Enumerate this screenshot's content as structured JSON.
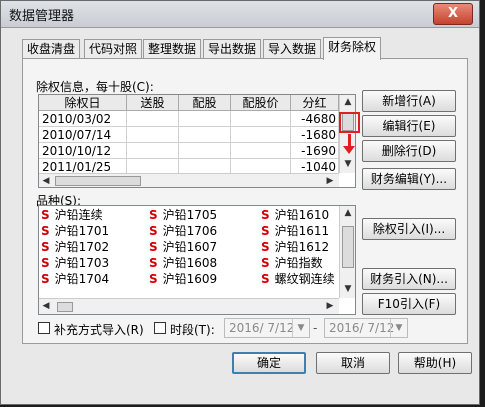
{
  "window": {
    "title": "数据管理器",
    "close_label": "X"
  },
  "tabs": [
    "收盘清盘",
    "代码对照",
    "整理数据",
    "导出数据",
    "导入数据",
    "财务除权"
  ],
  "rights_section": {
    "label": "除权信息，每十股(C):"
  },
  "grid": {
    "columns": [
      "除权日",
      "送股",
      "配股",
      "配股价",
      "分红"
    ],
    "rows": [
      [
        "2010/03/02",
        "",
        "",
        "",
        "-4680"
      ],
      [
        "2010/07/14",
        "",
        "",
        "",
        "-1680"
      ],
      [
        "2010/10/12",
        "",
        "",
        "",
        "-1690"
      ],
      [
        "2011/01/25",
        "",
        "",
        "",
        "-1040"
      ]
    ]
  },
  "buttons": {
    "add_row": "新增行(A)",
    "edit_row": "编辑行(E)",
    "delete_row": "删除行(D)",
    "finance_edit": "财务编辑(Y)...",
    "rights_import": "除权引入(I)...",
    "finance_import": "财务引入(N)...",
    "f10_import": "F10引入(F)",
    "ok": "确定",
    "cancel": "取消",
    "help": "帮助(H)"
  },
  "variety_section": {
    "label": "品种(S):"
  },
  "varieties": [
    [
      "沪铅连续",
      "沪铅1705",
      "沪铅1610"
    ],
    [
      "沪铅1701",
      "沪铅1706",
      "沪铅1611"
    ],
    [
      "沪铅1702",
      "沪铅1607",
      "沪铅1612"
    ],
    [
      "沪铅1703",
      "沪铅1608",
      "沪铅指数"
    ],
    [
      "沪铅1704",
      "沪铅1609",
      "螺纹钢连续"
    ]
  ],
  "variety_icon": "S",
  "options": {
    "supplement_import": "补充方式导入(R)",
    "period": "时段(T):",
    "date_from": "2016/ 7/12",
    "date_to": "2016/ 7/12",
    "dash": "-"
  },
  "colors": {
    "icon_red": "#d00000",
    "highlight_red": "#e02020",
    "default_button_border": "#3c7fb1"
  }
}
